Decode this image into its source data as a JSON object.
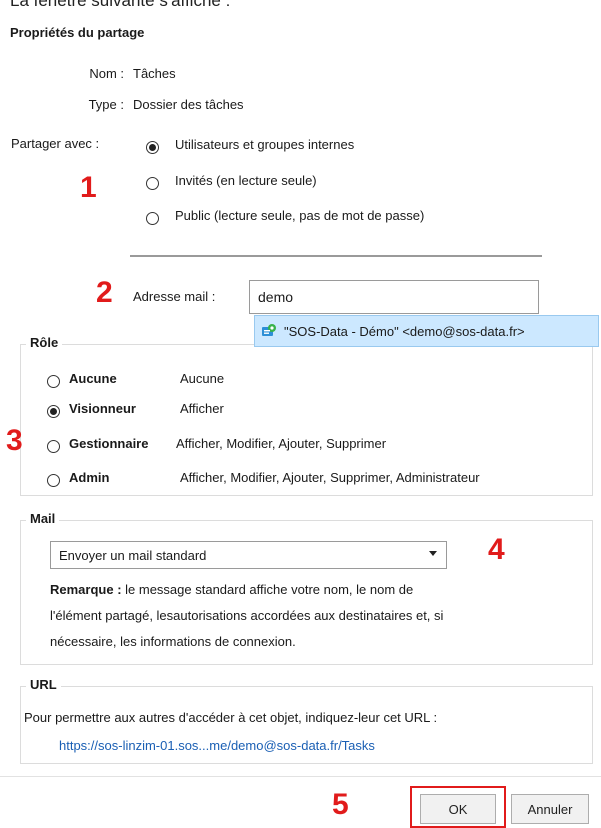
{
  "top_caption": "La fenêtre suivante s'affiche :",
  "dialog_title": "Propriétés du partage",
  "info": {
    "name_label": "Nom :",
    "name_value": "Tâches",
    "type_label": "Type :",
    "type_value": "Dossier des tâches"
  },
  "share": {
    "label": "Partager avec :",
    "options": [
      {
        "label": "Utilisateurs et groupes internes",
        "checked": true
      },
      {
        "label": "Invités (en lecture seule)",
        "checked": false
      },
      {
        "label": "Public (lecture seule, pas de mot de passe)",
        "checked": false
      }
    ]
  },
  "email": {
    "label": "Adresse mail :",
    "value": "demo",
    "suggestion": "\"SOS-Data - Démo\" <demo@sos-data.fr>"
  },
  "role": {
    "legend": "Rôle",
    "options": [
      {
        "name": "Aucune",
        "desc": "Aucune",
        "checked": false
      },
      {
        "name": "Visionneur",
        "desc": "Afficher",
        "checked": true
      },
      {
        "name": "Gestionnaire",
        "desc": "Afficher, Modifier, Ajouter, Supprimer",
        "checked": false
      },
      {
        "name": "Admin",
        "desc": "Afficher, Modifier, Ajouter, Supprimer, Administrateur",
        "checked": false
      }
    ]
  },
  "mail": {
    "legend": "Mail",
    "select_value": "Envoyer un mail standard",
    "note_bold": "Remarque :",
    "note_line1": " le message standard affiche votre nom, le nom de",
    "note_line2": "l'élément partagé, lesautorisations accordées aux destinataires et, si",
    "note_line3": "nécessaire, les informations de connexion."
  },
  "url": {
    "legend": "URL",
    "text": "Pour permettre aux autres d'accéder à cet objet, indiquez-leur cet URL :",
    "link": "https://sos-linzim-01.sos...me/demo@sos-data.fr/Tasks"
  },
  "buttons": {
    "ok": "OK",
    "cancel": "Annuler"
  },
  "step_numbers": [
    "1",
    "2",
    "3",
    "4",
    "5"
  ],
  "colors": {
    "annotation": "#e11b1b",
    "link": "#1a5fb4",
    "selection": "#cce8ff"
  }
}
